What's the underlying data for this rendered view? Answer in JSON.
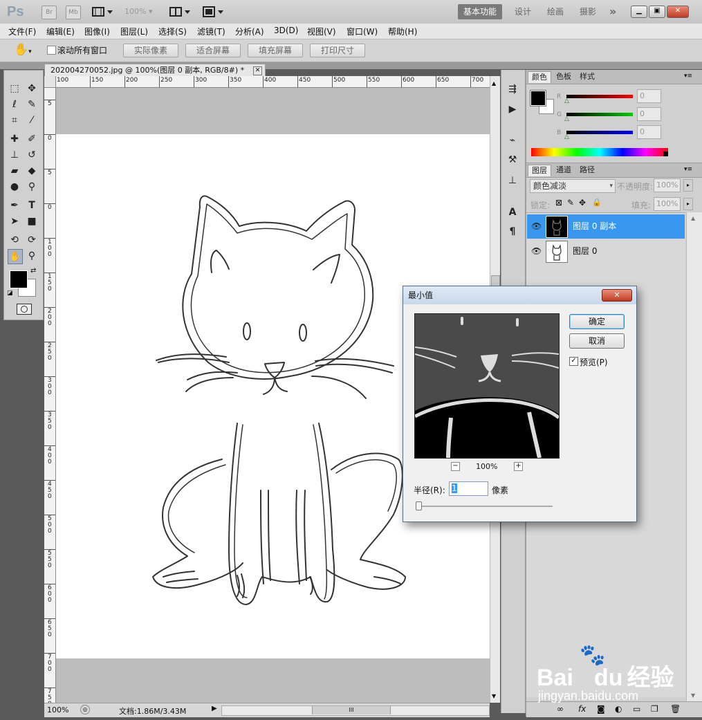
{
  "titlebar": {
    "logo": "Ps",
    "br": "Br",
    "mb": "Mb",
    "zoom": "100%",
    "workspaces": [
      "基本功能",
      "设计",
      "绘画",
      "摄影"
    ],
    "more": "»"
  },
  "menu": [
    "文件(F)",
    "编辑(E)",
    "图像(I)",
    "图层(L)",
    "选择(S)",
    "滤镜(T)",
    "分析(A)",
    "3D(D)",
    "视图(V)",
    "窗口(W)",
    "帮助(H)"
  ],
  "options": {
    "scroll_all_label": "滚动所有窗口",
    "buttons": [
      "实际像素",
      "适合屏幕",
      "填充屏幕",
      "打印尺寸"
    ]
  },
  "document": {
    "tab_title": "202004270052.jpg @ 100%(图层 0 副本, RGB/8#) *",
    "ruler_top": [
      "100",
      "150",
      "200",
      "250",
      "300",
      "350",
      "400",
      "450",
      "500",
      "550",
      "600",
      "650",
      "700"
    ],
    "ruler_left": [
      "5",
      "0",
      "5",
      "0",
      "1\n0\n0",
      "1\n5\n0",
      "2\n0\n0",
      "2\n5\n0",
      "3\n0\n0",
      "3\n5\n0",
      "4\n0\n0",
      "4\n5\n0",
      "5\n0\n0",
      "5\n5\n0",
      "6\n0\n0",
      "6\n5\n0",
      "7\n0\n0",
      "7\n5\n0"
    ],
    "status_zoom": "100%",
    "status_doc": "文档:1.86M/3.43M"
  },
  "color_panel": {
    "tabs": [
      "颜色",
      "色板",
      "样式"
    ],
    "channels": [
      {
        "label": "R",
        "value": "0"
      },
      {
        "label": "G",
        "value": "0"
      },
      {
        "label": "B",
        "value": "0"
      }
    ]
  },
  "layers_panel": {
    "tabs": [
      "图层",
      "通道",
      "路径"
    ],
    "blend_mode": "颜色减淡",
    "opacity_label": "不透明度:",
    "opacity": "100%",
    "lock_label": "锁定:",
    "fill_label": "填充:",
    "fill": "100%",
    "layers": [
      {
        "name": "图层 0 副本",
        "selected": true
      },
      {
        "name": "图层 0",
        "selected": false
      }
    ]
  },
  "dialog": {
    "title": "最小值",
    "ok": "确定",
    "cancel": "取消",
    "preview_label": "预览(P)",
    "preview_checked": true,
    "zoom": "100%",
    "zoom_minus": "−",
    "zoom_plus": "+",
    "radius_label": "半径(R):",
    "radius_value": "1",
    "radius_unit": "像素",
    "close": "✕"
  },
  "watermark": {
    "brand": "Bai",
    "brand2": "du",
    "cn": "经验",
    "url": "jingyan.baidu.com"
  }
}
